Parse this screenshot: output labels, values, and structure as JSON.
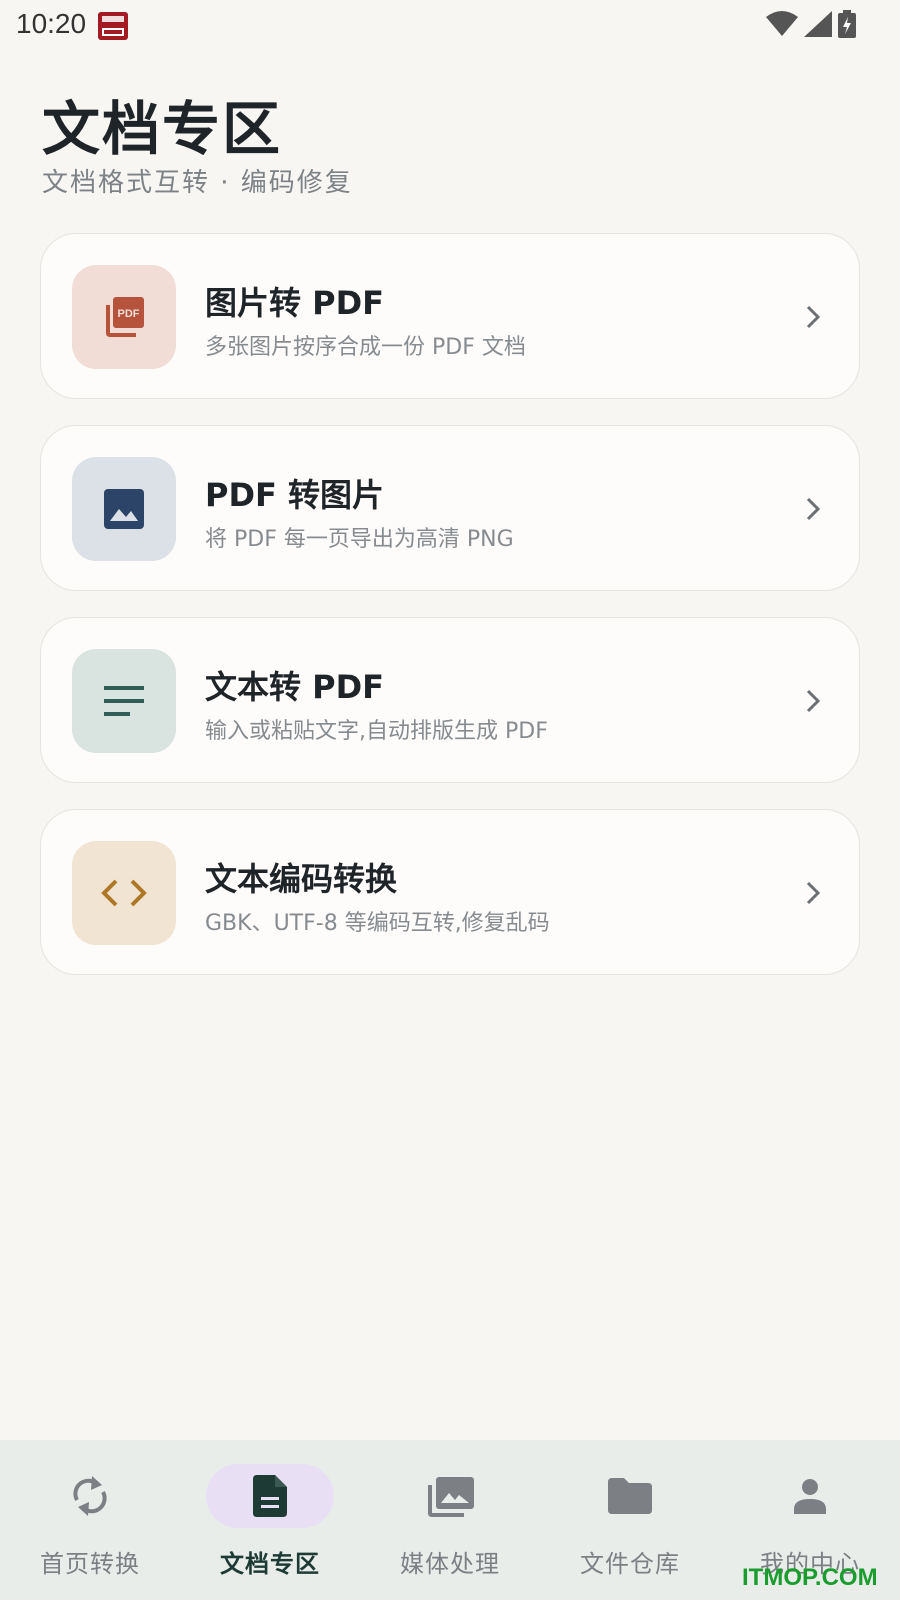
{
  "status_bar": {
    "time": "10:20"
  },
  "header": {
    "title": "文档专区",
    "subtitle": "文档格式互转 · 编码修复"
  },
  "cards": [
    {
      "title": "图片转 PDF",
      "desc": "多张图片按序合成一份 PDF 文档",
      "icon": "pdf-icon",
      "icon_bg": "#f1ddd6",
      "icon_color": "#b5533c"
    },
    {
      "title": "PDF 转图片",
      "desc": "将 PDF 每一页导出为高清 PNG",
      "icon": "image-icon",
      "icon_bg": "#dce1e7",
      "icon_color": "#2c4468"
    },
    {
      "title": "文本转 PDF",
      "desc": "输入或粘贴文字,自动排版生成 PDF",
      "icon": "text-lines-icon",
      "icon_bg": "#d9e3e0",
      "icon_color": "#2f5e57"
    },
    {
      "title": "文本编码转换",
      "desc": "GBK、UTF-8 等编码互转,修复乱码",
      "icon": "code-icon",
      "icon_bg": "#f1e4d2",
      "icon_color": "#ad7726"
    }
  ],
  "bottom_nav": [
    {
      "label": "首页转换",
      "icon": "sync-icon",
      "active": false
    },
    {
      "label": "文档专区",
      "icon": "document-icon",
      "active": true
    },
    {
      "label": "媒体处理",
      "icon": "media-icon",
      "active": false
    },
    {
      "label": "文件仓库",
      "icon": "folder-icon",
      "active": false
    },
    {
      "label": "我的中心",
      "icon": "person-icon",
      "active": false
    }
  ],
  "watermark": "ITMOP.COM"
}
